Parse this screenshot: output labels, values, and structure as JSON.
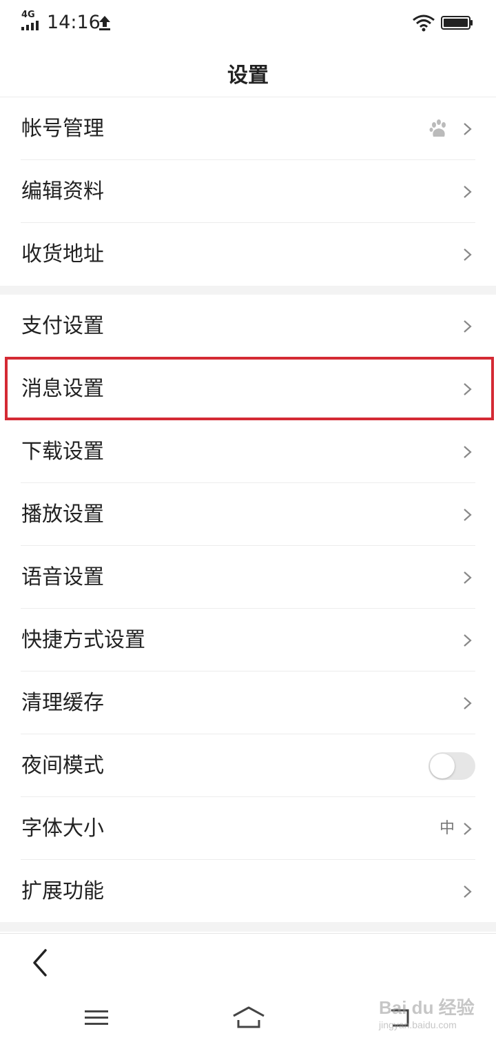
{
  "status_bar": {
    "network": "4G",
    "time": "14:16",
    "icons": [
      "signal-icon",
      "upload-icon",
      "wifi-icon",
      "battery-icon"
    ]
  },
  "header": {
    "title": "设置"
  },
  "groups": [
    [
      {
        "label": "帐号管理",
        "trailing_icon": "baidu-paw-icon"
      },
      {
        "label": "编辑资料"
      },
      {
        "label": "收货地址"
      }
    ],
    [
      {
        "label": "支付设置"
      },
      {
        "label": "消息设置",
        "highlighted": true
      },
      {
        "label": "下载设置"
      },
      {
        "label": "播放设置"
      },
      {
        "label": "语音设置"
      },
      {
        "label": "快捷方式设置"
      },
      {
        "label": "清理缓存"
      },
      {
        "label": "夜间模式",
        "toggle": "off"
      },
      {
        "label": "字体大小",
        "value": "中"
      },
      {
        "label": "扩展功能"
      }
    ]
  ],
  "colors": {
    "highlight_border": "#d42a34",
    "text": "#222222",
    "section_gap": "#f3f3f3"
  },
  "watermark": {
    "text": "Bai du 经验",
    "subtext": "jingyan.baidu.com"
  }
}
